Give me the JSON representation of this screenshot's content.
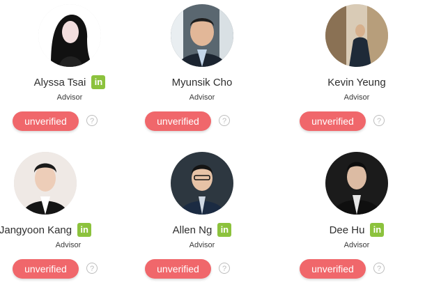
{
  "advisors": [
    {
      "name": "Alyssa Tsai",
      "role": "Advisor",
      "status": "unverified",
      "help": "?",
      "linkedin": "in",
      "has_linkedin": true
    },
    {
      "name": "Myunsik Cho",
      "role": "Advisor",
      "status": "unverified",
      "help": "?",
      "linkedin": "",
      "has_linkedin": false
    },
    {
      "name": "Kevin Yeung",
      "role": "Advisor",
      "status": "unverified",
      "help": "?",
      "linkedin": "",
      "has_linkedin": false
    },
    {
      "name": "Jangyoon Kang",
      "role": "Advisor",
      "status": "unverified",
      "help": "?",
      "linkedin": "in",
      "has_linkedin": true
    },
    {
      "name": "Allen Ng",
      "role": "Advisor",
      "status": "unverified",
      "help": "?",
      "linkedin": "in",
      "has_linkedin": true
    },
    {
      "name": "Dee Hu",
      "role": "Advisor",
      "status": "unverified",
      "help": "?",
      "linkedin": "in",
      "has_linkedin": true
    }
  ],
  "colors": {
    "button_bg": "#f0676b",
    "linkedin_bg": "#8cc23d",
    "help_border": "#bdbdbd"
  },
  "icons": {
    "linkedin": "linkedin-icon",
    "help": "help-icon"
  }
}
